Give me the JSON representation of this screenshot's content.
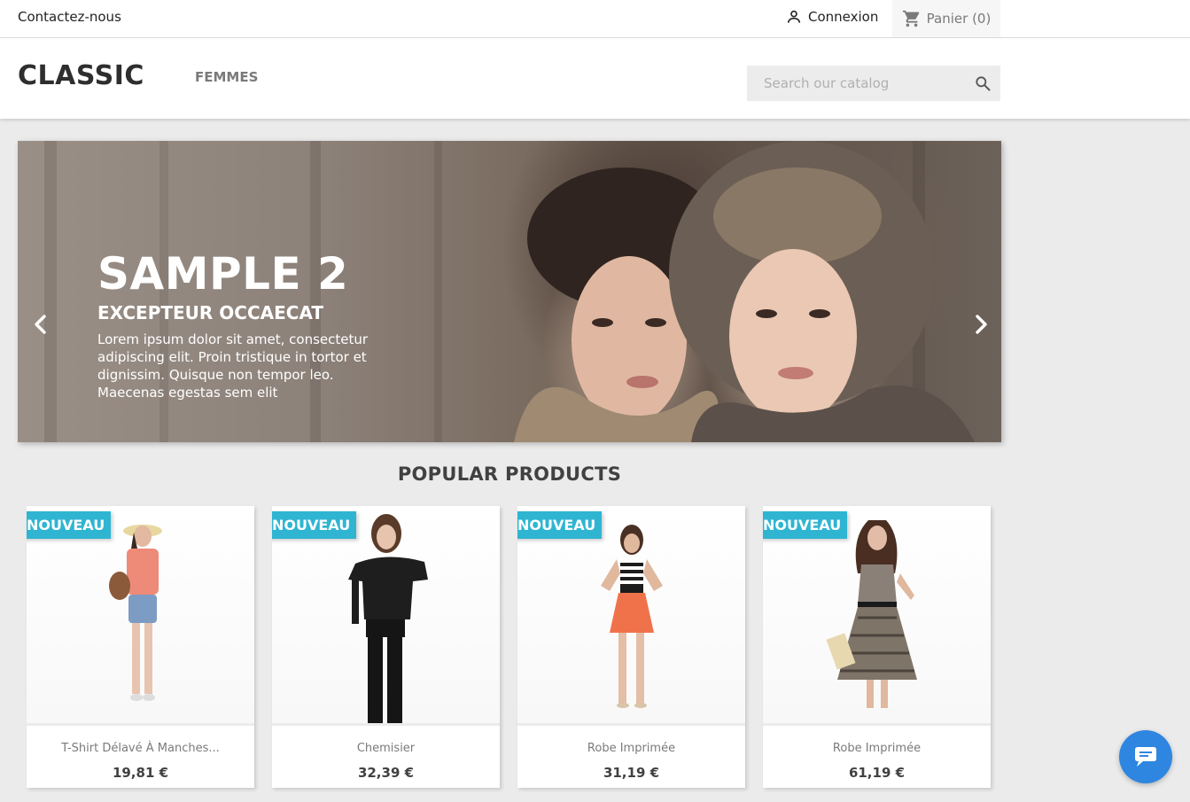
{
  "topnav": {
    "contact_label": "Contactez-nous",
    "login_label": "Connexion",
    "cart_label": "Panier (0)"
  },
  "header": {
    "logo": "CLASSIC",
    "menu": [
      {
        "label": "FEMMES"
      }
    ],
    "search_placeholder": "Search our catalog"
  },
  "carousel": {
    "title": "SAMPLE 2",
    "subtitle": "EXCEPTEUR OCCAECAT",
    "description": "Lorem ipsum dolor sit amet, consectetur adipiscing elit. Proin tristique in tortor et dignissim. Quisque non tempor leo. Maecenas egestas sem elit"
  },
  "products_section": {
    "title": "POPULAR PRODUCTS",
    "items": [
      {
        "badge": "NOUVEAU",
        "name": "T-Shirt Délavé À Manches...",
        "price": "19,81 €"
      },
      {
        "badge": "NOUVEAU",
        "name": "Chemisier",
        "price": "32,39 €"
      },
      {
        "badge": "NOUVEAU",
        "name": "Robe Imprimée",
        "price": "31,19 €"
      },
      {
        "badge": "NOUVEAU",
        "name": "Robe Imprimée",
        "price": "61,19 €"
      }
    ]
  },
  "colors": {
    "badge": "#2fb5d2",
    "chat": "#2e86e0"
  },
  "icons": {
    "login": "person-icon",
    "cart": "shopping-cart-icon",
    "search": "search-icon",
    "prev": "chevron-left-icon",
    "next": "chevron-right-icon",
    "chat": "chat-bubble-icon"
  }
}
